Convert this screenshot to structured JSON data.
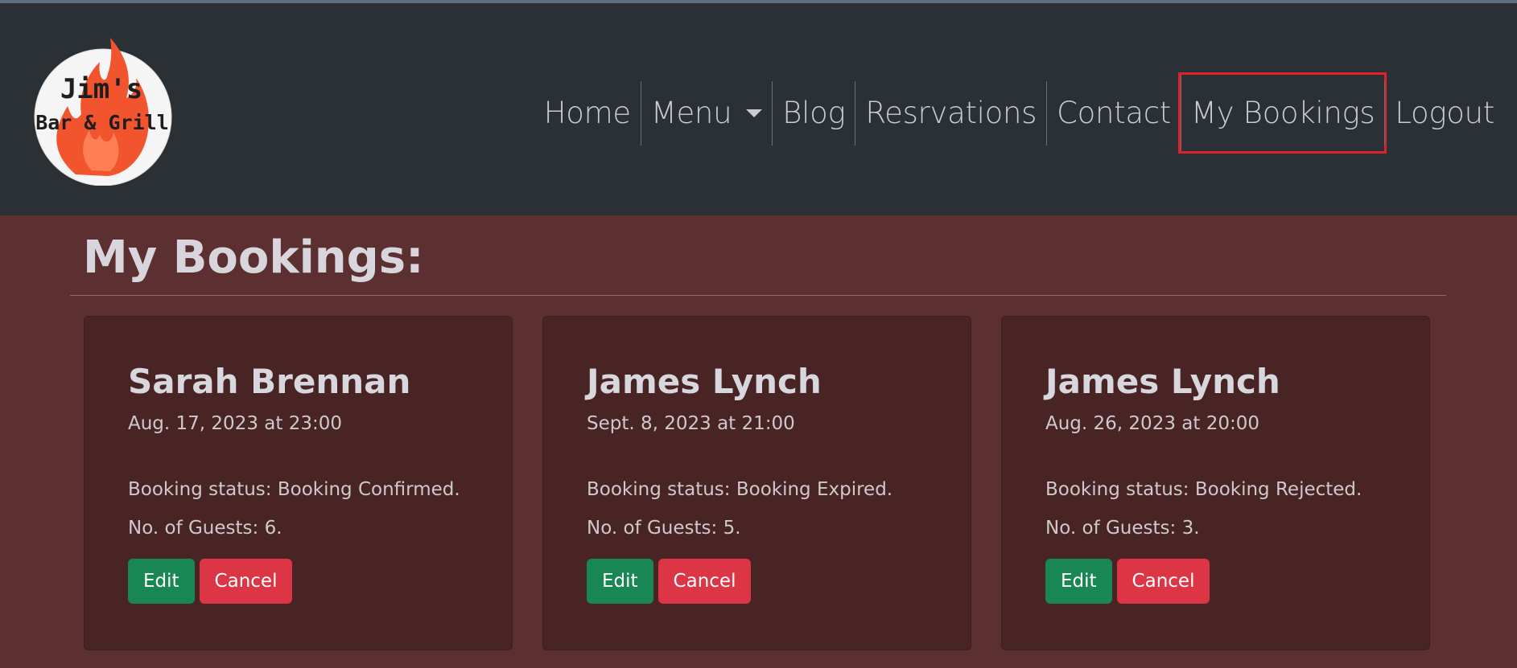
{
  "logo": {
    "line1": "Jim's",
    "line2": "Bar & Grill"
  },
  "nav": {
    "items": [
      {
        "label": "Home"
      },
      {
        "label": "Menu"
      },
      {
        "label": "Blog"
      },
      {
        "label": "Resrvations"
      },
      {
        "label": "Contact"
      },
      {
        "label": "My Bookings"
      },
      {
        "label": "Logout"
      }
    ]
  },
  "page": {
    "title": "My Bookings:"
  },
  "bookings": [
    {
      "name": "Sarah Brennan",
      "date": "Aug. 17, 2023 at 23:00",
      "status": "Booking status: Booking Confirmed.",
      "guests": "No. of Guests: 6.",
      "edit": "Edit",
      "cancel": "Cancel"
    },
    {
      "name": "James Lynch",
      "date": "Sept. 8, 2023 at 21:00",
      "status": "Booking status: Booking Expired.",
      "guests": "No. of Guests: 5.",
      "edit": "Edit",
      "cancel": "Cancel"
    },
    {
      "name": "James Lynch",
      "date": "Aug. 26, 2023 at 20:00",
      "status": "Booking status: Booking Rejected.",
      "guests": "No. of Guests: 3.",
      "edit": "Edit",
      "cancel": "Cancel"
    }
  ],
  "colors": {
    "navbar_bg": "#2b3035",
    "page_bg": "#5c2f30",
    "card_bg": "#482425",
    "edit_button": "#198754",
    "cancel_button": "#dc3545",
    "highlight_outline": "#e0202a",
    "flame": "#f2542d"
  }
}
